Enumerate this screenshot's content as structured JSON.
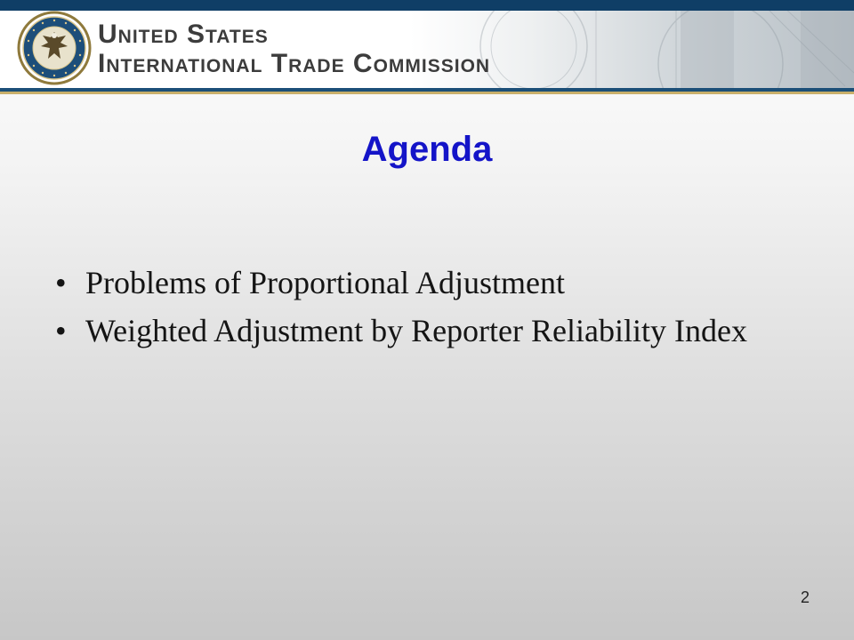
{
  "header": {
    "agency_line1": "United States",
    "agency_line2": "International Trade Commission",
    "seal_text": "UNITED STATES INTERNATIONAL TRADE COMMISSION"
  },
  "slide": {
    "title": "Agenda",
    "bullets": [
      {
        "mark": "•",
        "text": "Problems of Proportional Adjustment"
      },
      {
        "mark": "•",
        "text": "Weighted Adjustment by Reporter Reliability Index"
      }
    ],
    "page_number": "2"
  },
  "colors": {
    "title": "#1414c8",
    "header_stripe": "#0f3e66",
    "gold_accent": "#c9b06b",
    "body_text": "#141414"
  }
}
